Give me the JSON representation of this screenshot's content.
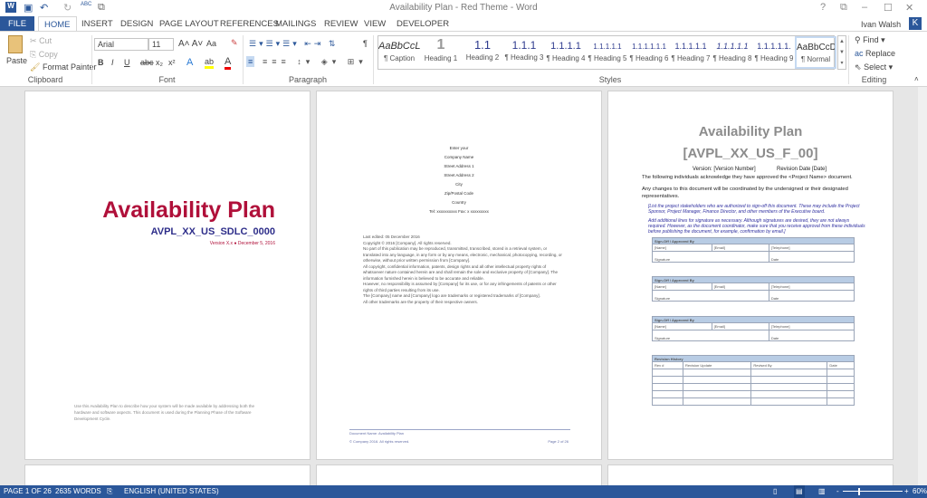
{
  "window": {
    "title": "Availability Plan - Red Theme - Word",
    "help": "?",
    "controls": [
      "⧉",
      "–",
      "☐",
      "✕"
    ]
  },
  "quick_access": {
    "save": "💾",
    "undo": "↶",
    "redo": "↻",
    "spelling": "ABC"
  },
  "tabs": [
    "FILE",
    "HOME",
    "INSERT",
    "DESIGN",
    "PAGE LAYOUT",
    "REFERENCES",
    "MAILINGS",
    "REVIEW",
    "VIEW",
    "DEVELOPER"
  ],
  "user": {
    "name": "Ivan Walsh",
    "initial": "K"
  },
  "clipboard": {
    "paste": "Paste",
    "cut": "Cut",
    "copy": "Copy",
    "format_painter": "Format Painter",
    "label": "Clipboard"
  },
  "font": {
    "name": "Arial",
    "size": "11",
    "label": "Font",
    "bold": "B",
    "italic": "I",
    "underline": "U",
    "strike": "abc",
    "sub": "x₂",
    "sup": "x²",
    "case": "Aa"
  },
  "paragraph": {
    "label": "Paragraph",
    "pilcrow": "¶"
  },
  "styles": {
    "label": "Styles",
    "items": [
      {
        "sample": "AaBbCcL",
        "name": "¶ Caption"
      },
      {
        "sample": "1",
        "name": "Heading 1"
      },
      {
        "sample": "1.1",
        "name": "Heading 2"
      },
      {
        "sample": "1.1.1",
        "name": "¶ Heading 3"
      },
      {
        "sample": "1.1.1.1",
        "name": "¶ Heading 4"
      },
      {
        "sample": "1.1.1.1.1",
        "name": "¶ Heading 5"
      },
      {
        "sample": "1.1.1.1.1.1",
        "name": "¶ Heading 6"
      },
      {
        "sample": "1.1.1.1.1",
        "name": "¶ Heading 7"
      },
      {
        "sample": "1.1.1.1.1",
        "name": "¶ Heading 8"
      },
      {
        "sample": "1.1.1.1.1.",
        "name": "¶ Heading 9"
      },
      {
        "sample": "AaBbCcD",
        "name": "¶ Normal"
      }
    ]
  },
  "editing": {
    "find": "Find",
    "replace": "Replace",
    "select": "Select",
    "label": "Editing"
  },
  "page1": {
    "title": "Availability Plan",
    "code": "AVPL_XX_US_SDLC_0000",
    "version": "Version X.x ● December 5, 2016",
    "desc": "Use this Availability Plan to describe how your system will be made available by addressing both the hardware and software aspects. This document is used during the Planning Phase of the Software Development Cycle."
  },
  "page2": {
    "address": [
      "Enter your",
      "Company Name",
      "Street Address 1",
      "Street Address 2",
      "City",
      "Zip/Postal Code",
      "Country",
      "Tel: xxxxxxxxxx Fax: x xxxxxxxxx"
    ],
    "legal": [
      "Last edited: 05 December 2016",
      "Copyright © 2016 [Company].  All rights reserved.",
      "No part of this publication may be reproduced, transmitted, transcribed, stored in a retrieval system, or translated into any language, in any form or by any means, electronic, mechanical, photocopying, recording, or otherwise, without prior written permission from [Company].",
      "All copyright, confidential information, patents, design rights and all other intellectual property rights of whatsoever nature contained herein are and shall remain the sole and exclusive property of [Company]. The information furnished herein is believed to be accurate and reliable.",
      "However, no responsibility is assumed by [Company] for its use, or for any infringements of patents or other rights of third parties resulting from its use.",
      "The [Company] name and [Company] logo are trademarks or registered trademarks of [Company].",
      "All other trademarks are the property of their respective owners."
    ],
    "footer_name": "Document Name: Availability Plan",
    "footer_copy": "© Company 2016. All rights reserved.",
    "footer_page": "Page 2 of 26"
  },
  "page3": {
    "title": "Availability Plan",
    "code": "[AVPL_XX_US_F_00]",
    "version": "Version: [Version Number]",
    "revision": "Revision Date [Date]",
    "p1": "The following individuals acknowledge they have approved the <Project Name> document.",
    "p2": "Any changes to this document will be coordinated by the undersigned or their designated representatives.",
    "note1": "[List the project stakeholders who are authorized to sign-off this document. These may include the Project Sponsor, Project Manager, Finance Director, and other members of the Executive board.",
    "note2": "Add additional lines for signature as necessary. Although signatures are desired, they are not always required. However, as the document coordinator, make sure that you receive approval from these individuals before publishing the document, for example, confirmation by email.]",
    "signoff": {
      "header": "Sign-Off / Approved By",
      "name": "[Name]",
      "email": "[Email]",
      "phone": "[Telephone]",
      "signature": "Signature",
      "date": "Date"
    },
    "history": {
      "header": "Revision History",
      "cols": [
        "Rev #",
        "Revision Update",
        "Revised By",
        "Date"
      ]
    }
  },
  "status": {
    "page": "PAGE 1 OF 26",
    "words": "2635 WORDS",
    "language": "ENGLISH (UNITED STATES)",
    "zoom": "60%"
  }
}
